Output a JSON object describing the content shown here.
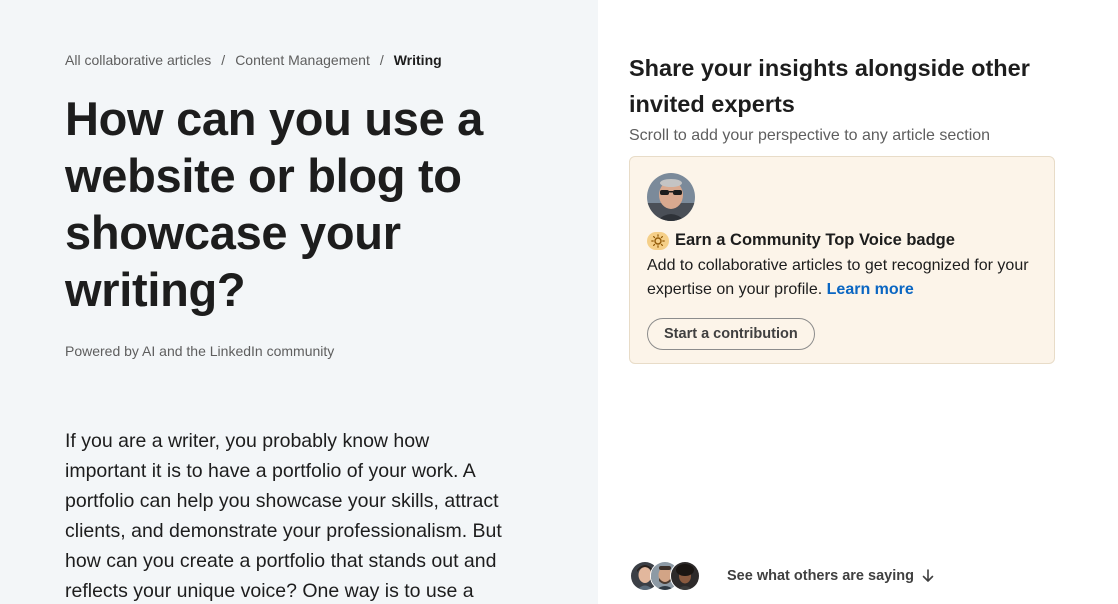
{
  "breadcrumb": {
    "items": [
      "All collaborative articles",
      "Content Management"
    ],
    "current": "Writing",
    "separator": "/"
  },
  "article": {
    "title": "How can you use a website or blog to showcase your writing?",
    "powered_by": "Powered by AI and the LinkedIn community",
    "intro": "If you are a writer, you probably know how important it is to have a portfolio of your work. A portfolio can help you showcase your skills, attract clients, and demonstrate your professionalism. But how can you create a portfolio that stands out and reflects your unique voice? One way is to use a"
  },
  "sidebar": {
    "heading": "Share your insights alongside other invited experts",
    "subtext": "Scroll to add your perspective to any article section",
    "card": {
      "badge_title": "Earn a Community Top Voice badge",
      "badge_icon": "lightbulb-icon",
      "text": "Add to collaborative articles to get recognized for your expertise on your profile.",
      "learn_more": "Learn more",
      "button": "Start a contribution",
      "background_color": "#fcf4e9"
    },
    "others": {
      "label": "See what others are saying",
      "icon": "arrow-down-icon"
    }
  },
  "colors": {
    "link": "#0a66c2",
    "left_background": "#f3f6f8",
    "text": "#1d1d1d",
    "muted": "#5e5e5e"
  }
}
